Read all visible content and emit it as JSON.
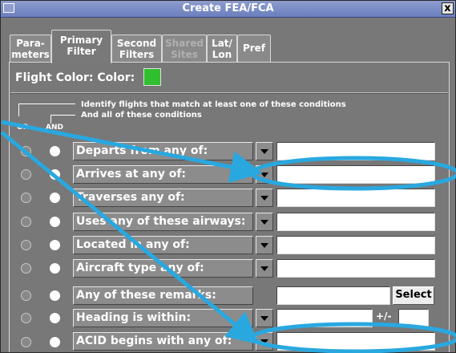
{
  "window": {
    "title": "Create FEA/FCA",
    "close_label": "x"
  },
  "tabs": [
    {
      "label": "Para-\nmeters",
      "state": "normal"
    },
    {
      "label": "Primary\nFilter",
      "state": "active"
    },
    {
      "label": "Second\nFilters",
      "state": "normal"
    },
    {
      "label": "Shared\nSites",
      "state": "disabled"
    },
    {
      "label": "Lat/\nLon",
      "state": "normal"
    },
    {
      "label": "Pref",
      "state": "normal"
    }
  ],
  "flight_color": {
    "label": "Flight Color: Color:",
    "color": "#2fbf2f"
  },
  "instructions": {
    "or_text": "Identify flights that match at least one of these conditions",
    "and_text": "And all of these  conditions"
  },
  "columns": {
    "or": "OR",
    "and": "AND"
  },
  "conditions": [
    {
      "label": "Departs from any of:",
      "value": ""
    },
    {
      "label": "Arrives at any of:",
      "value": ""
    },
    {
      "label": "Traverses any of:",
      "value": ""
    },
    {
      "label": "Uses any of these airways:",
      "value": ""
    },
    {
      "label": "Located in any of:",
      "value": ""
    },
    {
      "label": "Aircraft type any of:",
      "value": ""
    },
    {
      "label": "Any of these remarks:",
      "value": ""
    },
    {
      "label": "Heading is within:",
      "value": ""
    },
    {
      "label": "ACID begins with any of:",
      "value": ""
    }
  ],
  "select_button": "Select",
  "heading_plus_minus": "+/-",
  "annotation_color": "#29a8e0"
}
